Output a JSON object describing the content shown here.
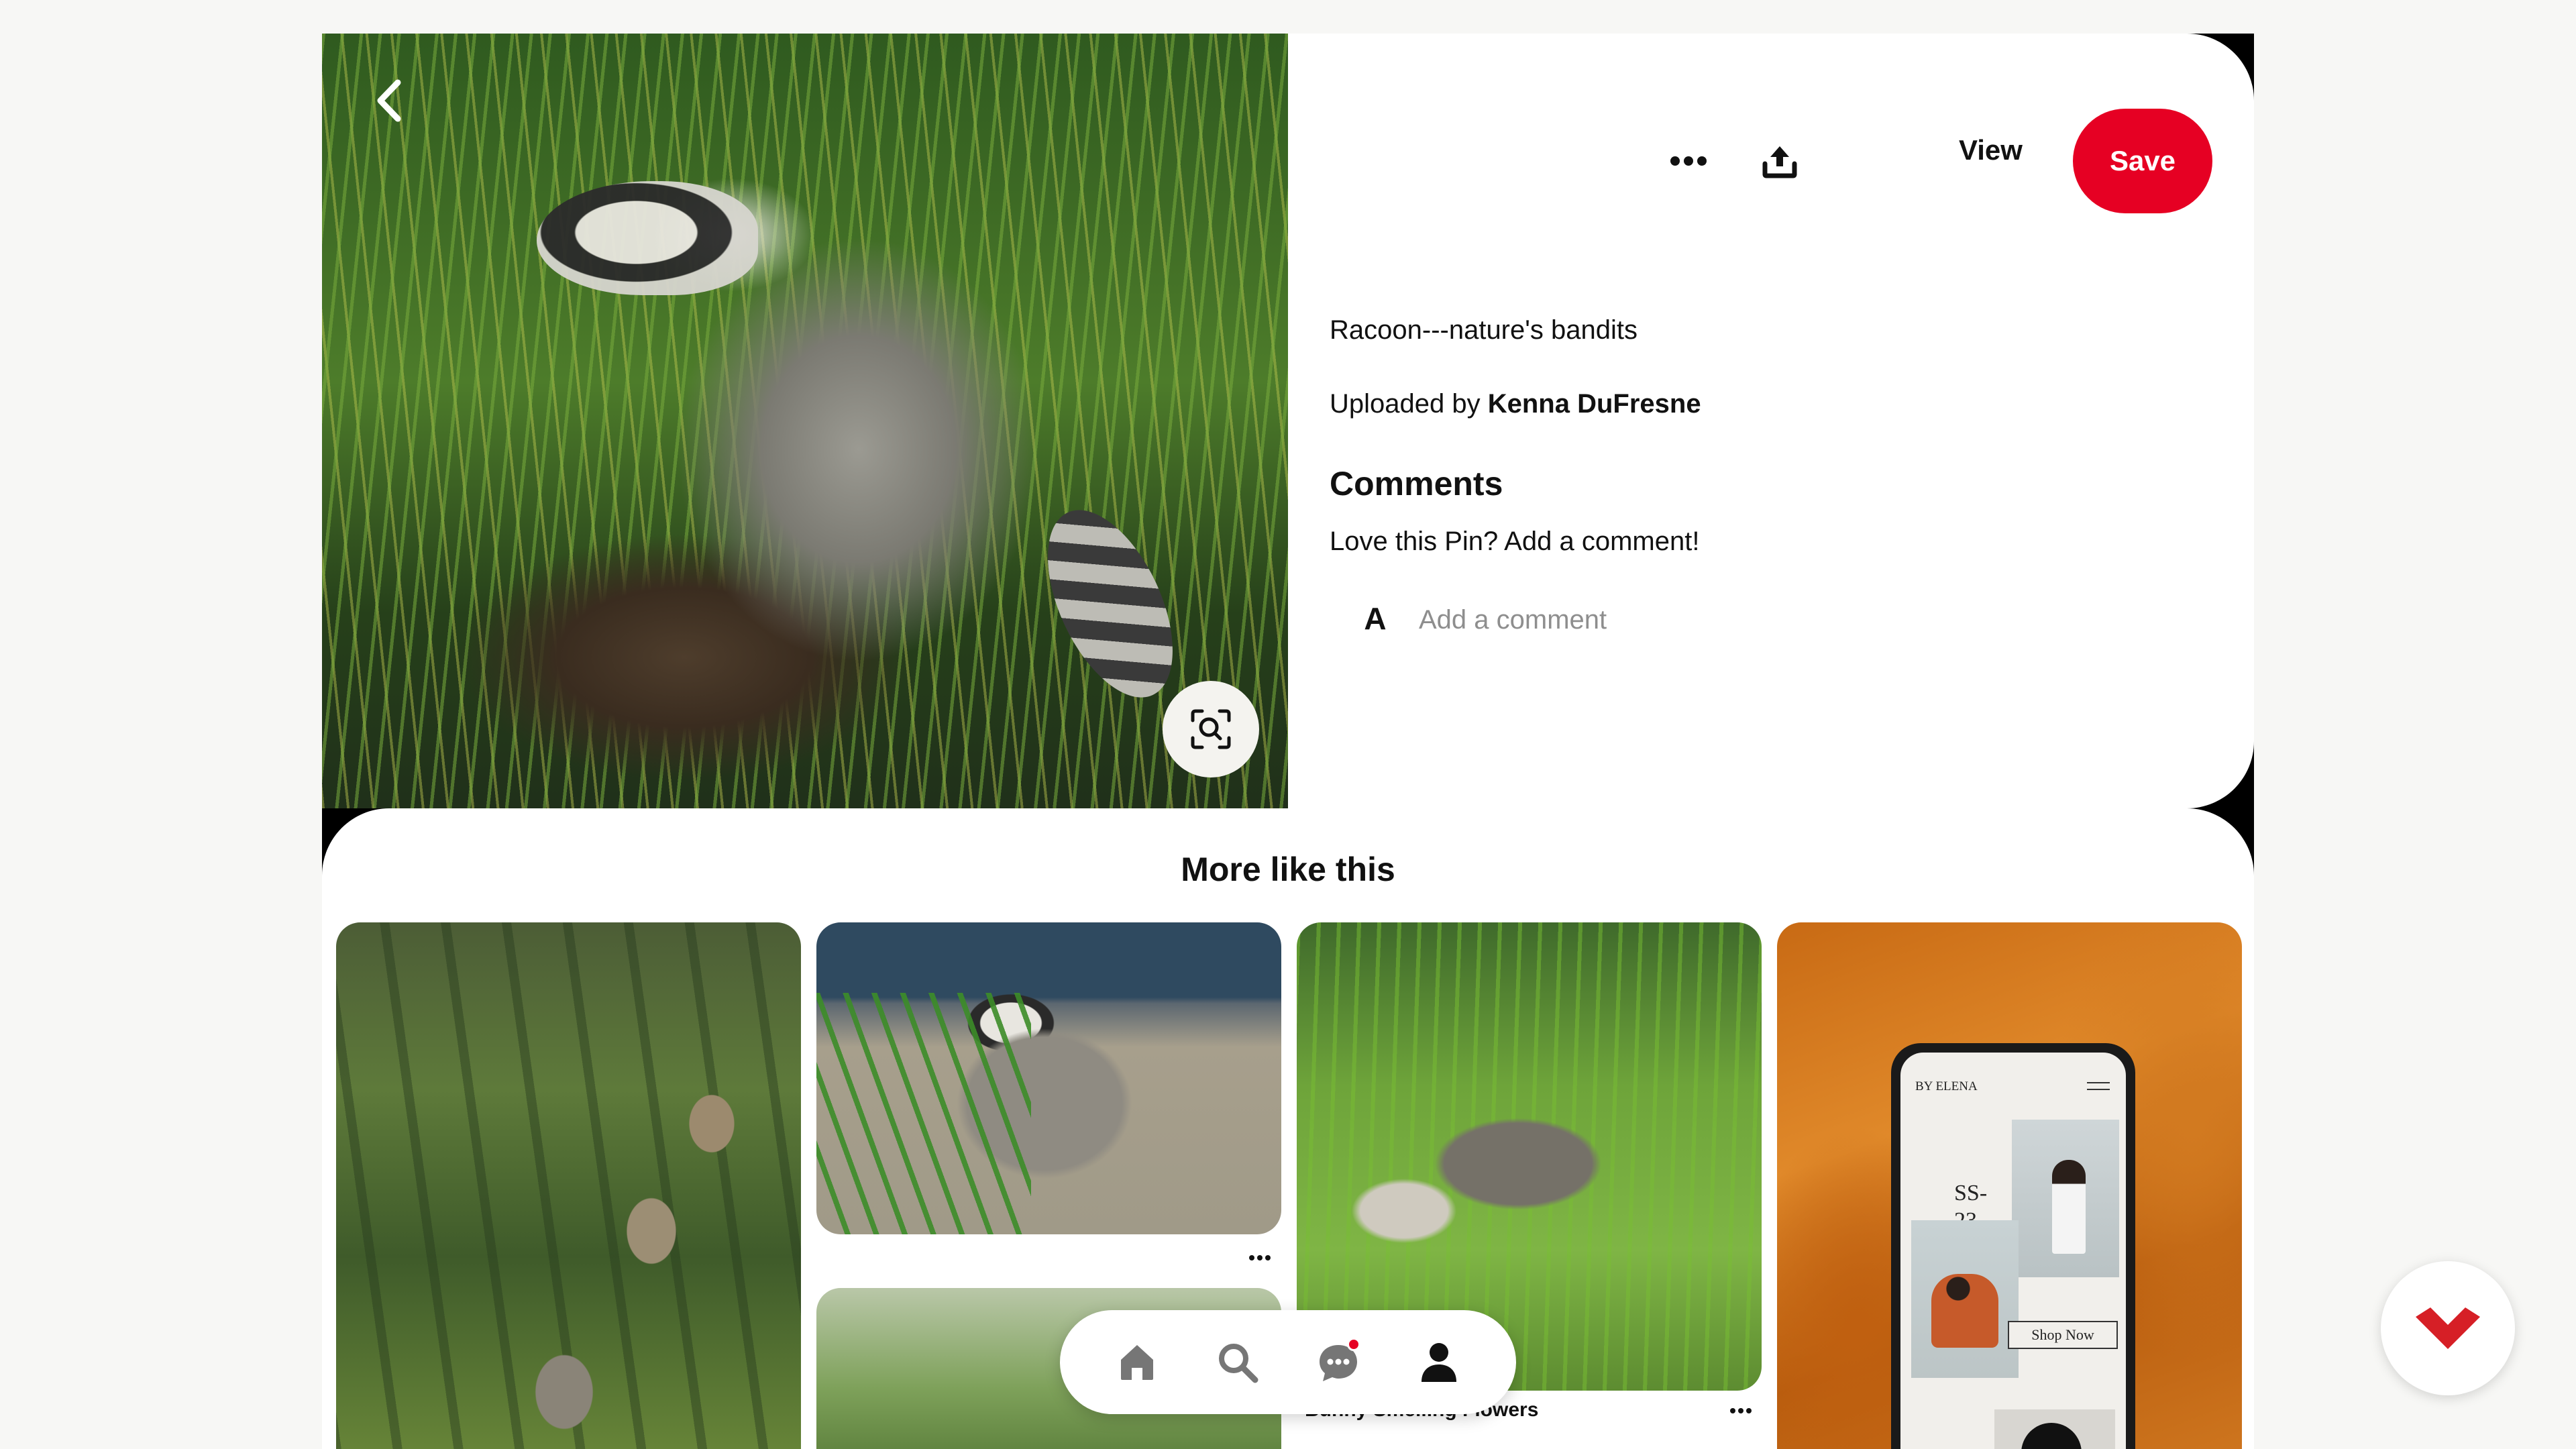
{
  "pin": {
    "title": "Racoon---nature's bandits",
    "uploaded_prefix": "Uploaded by ",
    "uploader": "Kenna DuFresne",
    "view_label": "View",
    "save_label": "Save"
  },
  "comments": {
    "title": "Comments",
    "prompt": "Love this Pin? Add a comment!",
    "avatar_initial": "A",
    "placeholder": "Add a comment"
  },
  "more_like_this": {
    "title": "More like this",
    "tiles": [
      {
        "icon": "raccoon-family-image"
      },
      {
        "icon": "raccoon-on-wall-image"
      },
      {
        "icon": "raccoon-smelling-flowers-image",
        "caption": "Bunny Smelling Flowers"
      },
      {
        "icon": "phone-mockup-ad-image",
        "brand": "BY ELENA",
        "headline": "SS-\n23",
        "cta": "Shop Now"
      },
      {
        "icon": "raccoon-in-grass-image"
      }
    ]
  },
  "nav": {
    "items": [
      "home-icon",
      "search-icon",
      "chat-icon",
      "profile-icon"
    ]
  },
  "colors": {
    "save_red": "#e60023",
    "accent_red": "#d61f26"
  }
}
